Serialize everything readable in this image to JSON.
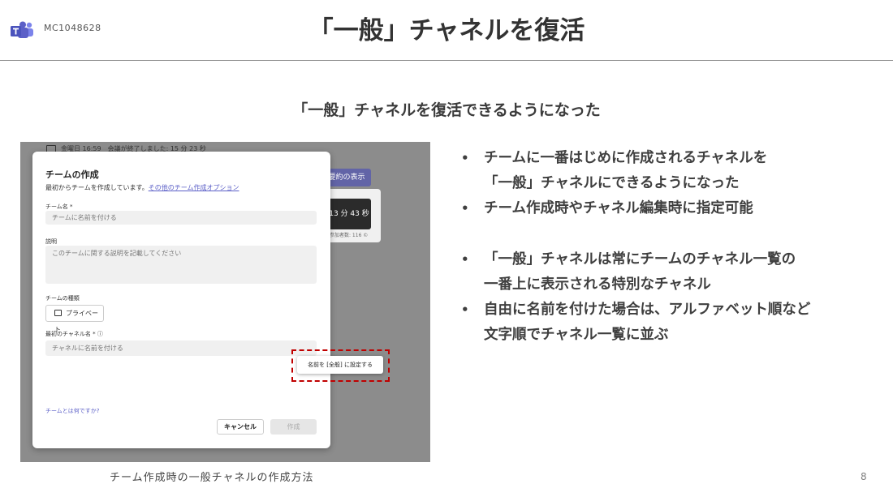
{
  "header": {
    "code": "MC1048628",
    "title": "「一般」チャネルを復活"
  },
  "subtitle": "「一般」チャネルを復活できるようになった",
  "screenshot": {
    "top_bar": "金曜日 16:59　会議が終了しました: 15 分 23 秒",
    "purple_button": "要約の表示",
    "timer": "13 分 43 秒",
    "small_text": "参加者数: 116 ©",
    "dialog": {
      "title": "チームの作成",
      "intro": "最初からチームを作成しています。",
      "intro_link": "その他のチーム作成オプション",
      "team_name_label": "チーム名 *",
      "team_name_placeholder": "チームに名前を付ける",
      "description_label": "説明",
      "description_placeholder": "このチームに関する説明を記載してください",
      "team_type_label": "チームの種類",
      "private_button": "プライベート",
      "channel_label": "最初のチャネル名 * ⓘ",
      "channel_placeholder": "チャネルに名前を付ける",
      "help_link": "チームとは何ですか?",
      "cancel": "キャンセル",
      "create": "作成"
    },
    "tooltip": "名前を [全般] に設定する"
  },
  "caption": "チーム作成時の一般チャネルの作成方法",
  "page_number": "8",
  "bullets": [
    [
      "チームに一番はじめに作成されるチャネルを",
      "「一般」チャネルにできるようになった"
    ],
    [
      "チーム作成時やチャネル編集時に指定可能"
    ],
    [
      "「一般」チャネルは常にチームのチャネル一覧の",
      "一番上に表示される特別なチャネル"
    ],
    [
      "自由に名前を付けた場合は、アルファベット順など",
      "文字順でチャネル一覧に並ぶ"
    ]
  ],
  "colors": {
    "teams_purple": "#6264a7",
    "highlight_red": "#c00000",
    "link": "#5b5fc7"
  }
}
